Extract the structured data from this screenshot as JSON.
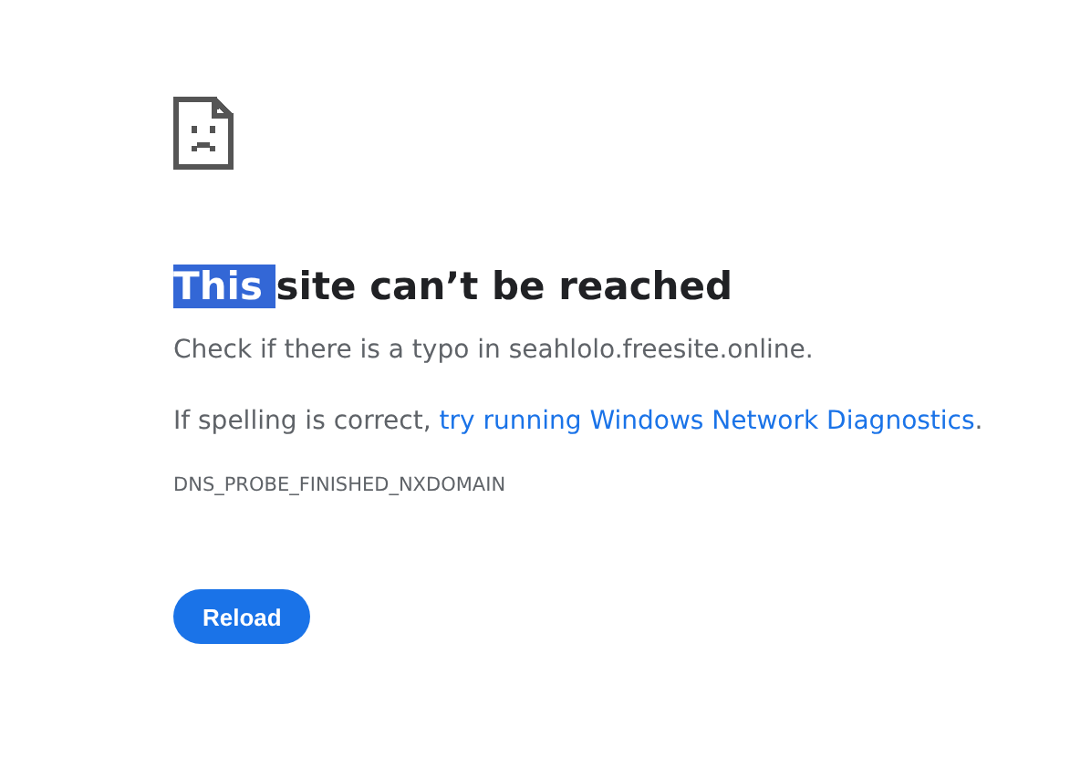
{
  "heading": {
    "highlighted": "This ",
    "text": "site can’t be reached"
  },
  "message": "Check if there is a typo in seahlolo.freesite.online.",
  "suggestion": {
    "text": "If spelling is correct, ",
    "link": "try running Windows Network Diagnostics",
    "end": "."
  },
  "error_code": "DNS_PROBE_FINISHED_NXDOMAIN",
  "buttons": [
    "Reload"
  ]
}
